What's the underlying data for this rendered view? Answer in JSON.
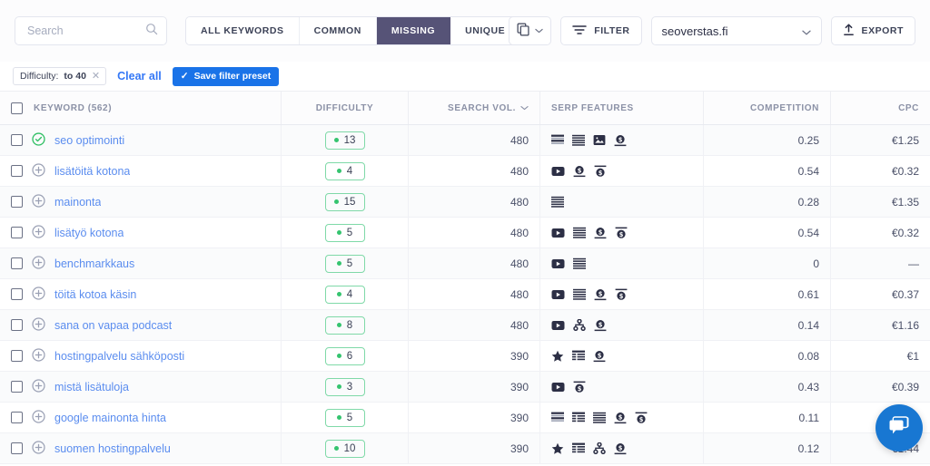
{
  "toolbar": {
    "search": {
      "placeholder": "Search",
      "value": ""
    },
    "tabs": [
      {
        "label": "ALL KEYWORDS",
        "active": false
      },
      {
        "label": "COMMON",
        "active": false
      },
      {
        "label": "MISSING",
        "active": true
      },
      {
        "label": "UNIQUE",
        "active": false
      }
    ],
    "compare_label": "",
    "filter_label": "FILTER",
    "domain_value": "seoverstas.fi",
    "export_label": "EXPORT"
  },
  "filterbar": {
    "chip_prefix": "Difficulty:",
    "chip_value": "to 40",
    "chip_close": "✕",
    "clear_all": "Clear all",
    "save_preset": "Save filter preset",
    "save_preset_check": "✓"
  },
  "table": {
    "columns": [
      {
        "label": "KEYWORD (562)"
      },
      {
        "label": "DIFFICULTY"
      },
      {
        "label": "SEARCH VOL."
      },
      {
        "label": "SERP FEATURES"
      },
      {
        "label": "COMPETITION"
      },
      {
        "label": "CPC"
      }
    ],
    "sorted_column": "SEARCH VOL.",
    "rows": [
      {
        "status": "check-circle-icon",
        "keyword": "seo optimointi",
        "difficulty": "13",
        "volume": "480",
        "serp": [
          "featured-snippet",
          "sitelinks-list",
          "image-pack",
          "ads-bottom"
        ],
        "competition": "0.25",
        "cpc": "€1.25"
      },
      {
        "status": "plus-circle-icon",
        "keyword": "lisätöitä kotona",
        "difficulty": "4",
        "volume": "480",
        "serp": [
          "video",
          "ads-bottom",
          "ads-top"
        ],
        "competition": "0.54",
        "cpc": "€0.32"
      },
      {
        "status": "plus-circle-icon",
        "keyword": "mainonta",
        "difficulty": "15",
        "volume": "480",
        "serp": [
          "sitelinks-list"
        ],
        "competition": "0.28",
        "cpc": "€1.35"
      },
      {
        "status": "plus-circle-icon",
        "keyword": "lisätyö kotona",
        "difficulty": "5",
        "volume": "480",
        "serp": [
          "video",
          "sitelinks-list",
          "ads-bottom",
          "ads-top"
        ],
        "competition": "0.54",
        "cpc": "€0.32"
      },
      {
        "status": "plus-circle-icon",
        "keyword": "benchmarkkaus",
        "difficulty": "5",
        "volume": "480",
        "serp": [
          "video",
          "sitelinks-list"
        ],
        "competition": "0",
        "cpc": "—"
      },
      {
        "status": "plus-circle-icon",
        "keyword": "töitä kotoa käsin",
        "difficulty": "4",
        "volume": "480",
        "serp": [
          "video",
          "sitelinks-list",
          "ads-bottom",
          "ads-top"
        ],
        "competition": "0.61",
        "cpc": "€0.37"
      },
      {
        "status": "plus-circle-icon",
        "keyword": "sana on vapaa podcast",
        "difficulty": "8",
        "volume": "480",
        "serp": [
          "video",
          "sitelinks-tree",
          "ads-bottom"
        ],
        "competition": "0.14",
        "cpc": "€1.16"
      },
      {
        "status": "plus-circle-icon",
        "keyword": "hostingpalvelu sähköposti",
        "difficulty": "6",
        "volume": "390",
        "serp": [
          "reviews",
          "table",
          "ads-bottom"
        ],
        "competition": "0.08",
        "cpc": "€1"
      },
      {
        "status": "plus-circle-icon",
        "keyword": "mistä lisätuloja",
        "difficulty": "3",
        "volume": "390",
        "serp": [
          "video",
          "ads-top"
        ],
        "competition": "0.43",
        "cpc": "€0.39"
      },
      {
        "status": "plus-circle-icon",
        "keyword": "google mainonta hinta",
        "difficulty": "5",
        "volume": "390",
        "serp": [
          "featured-snippet",
          "table",
          "sitelinks-list",
          "ads-bottom",
          "ads-top"
        ],
        "competition": "0.11",
        "cpc": ""
      },
      {
        "status": "plus-circle-icon",
        "keyword": "suomen hostingpalvelu",
        "difficulty": "10",
        "volume": "390",
        "serp": [
          "reviews",
          "table",
          "sitelinks-tree",
          "ads-bottom"
        ],
        "competition": "0.12",
        "cpc": "€1.44"
      }
    ]
  },
  "chat": {
    "label": "chat-widget"
  },
  "colors": {
    "active_tab": "#565377",
    "link": "#5b8def",
    "primary_button": "#1a73e8",
    "difficulty_green": "#35c46f",
    "chat_blue": "#1877d2"
  }
}
